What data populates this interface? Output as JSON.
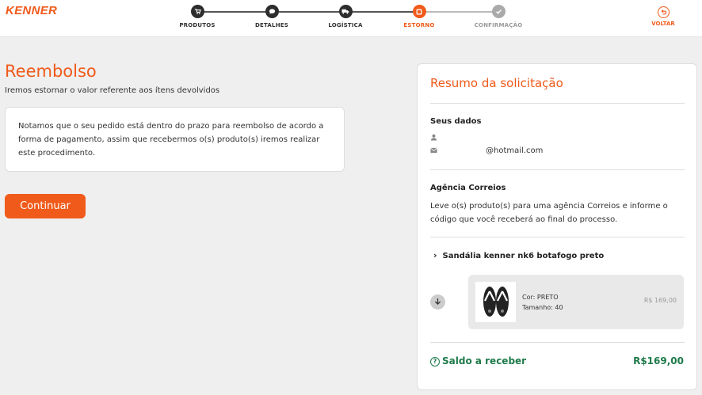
{
  "brand": {
    "logo_text": "KENNER",
    "accent": "#f05a1a",
    "success": "#1e7a4a"
  },
  "steps": [
    {
      "label": "PRODUTOS",
      "state": "done",
      "icon": "cart-icon"
    },
    {
      "label": "DETALHES",
      "state": "done",
      "icon": "chat-icon"
    },
    {
      "label": "LOGÍSTICA",
      "state": "done",
      "icon": "truck-icon"
    },
    {
      "label": "ESTORNO",
      "state": "active",
      "icon": "refund-icon"
    },
    {
      "label": "CONFIRMAÇÃO",
      "state": "pending",
      "icon": "check-icon"
    }
  ],
  "back": {
    "label": "VOLTAR",
    "icon": "back-icon"
  },
  "main": {
    "title": "Reembolso",
    "subtitle": "Iremos estornar o valor referente aos ítens devolvidos",
    "notice": "Notamos que o seu pedido está dentro do prazo para reembolso de acordo a forma de pagamento, assim que recebermos o(s) produto(s) iremos realizar este procedimento.",
    "continue_label": "Continuar"
  },
  "summary": {
    "title": "Resumo da solicitação",
    "your_data_title": "Seus dados",
    "email": "@hotmail.com",
    "agency_title": "Agência Correios",
    "agency_text": "Leve o(s) produto(s) para uma agência Correios e informe o código que você receberá ao final do processo.",
    "product_name": "Sandália kenner nk6 botafogo preto",
    "item": {
      "color": "Cor: PRETO",
      "size": "Tamanho: 40",
      "price": "R$ 169,00"
    },
    "balance_label": "Saldo a receber",
    "balance_value": "R$169,00"
  }
}
